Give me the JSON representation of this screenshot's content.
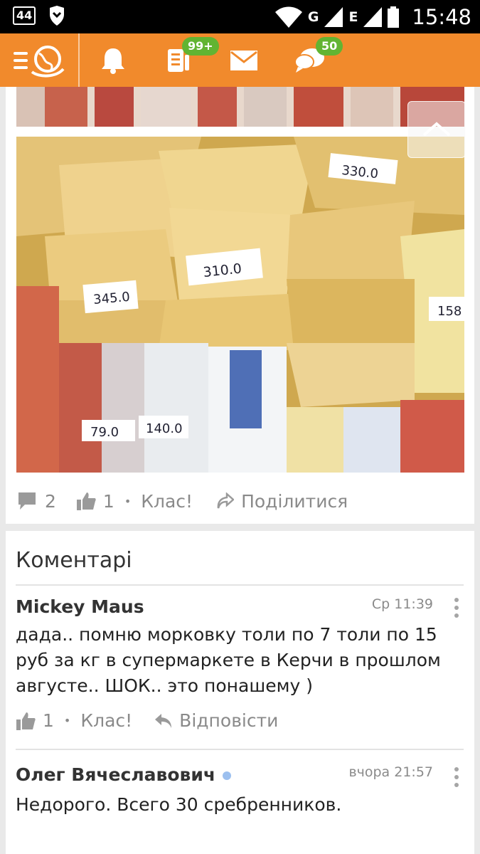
{
  "status_bar": {
    "notification_count": "44",
    "network_1": "G",
    "network_2": "E",
    "time": "15:48"
  },
  "app_bar": {
    "menu_icon": "menu-globe-icon",
    "notifications_icon": "bell-icon",
    "feed_icon": "feed-icon",
    "feed_badge": "99+",
    "messages_icon": "envelope-icon",
    "discussions_icon": "chat-bubbles-icon",
    "discussions_badge": "50",
    "accent": "#f18a2c",
    "badge_color": "#62b432"
  },
  "post": {
    "photo_1": "photo-sausages",
    "photo_2": "photo-cheese-and-butter",
    "price_tags": [
      "330.0",
      "310.0",
      "345.0",
      "158",
      "79.0",
      "140.0"
    ],
    "comments_count": "2",
    "likes_count": "1",
    "like_label": "Клас!",
    "share_label": "Поділитися"
  },
  "comments": {
    "title": "Коментарі",
    "items": [
      {
        "author": "Mickey Maus",
        "time": "Ср 11:39",
        "text": "дада.. помню морковку толи по 7 толи по 15 руб за кг в супермаркете в Керчи в прошлом августе.. ШОК.. это понашему )",
        "likes": "1",
        "like_label": "Клас!",
        "reply_label": "Відповісти"
      },
      {
        "author": "Олег Вячеславович",
        "time": "вчора 21:57",
        "text": "Недорого. Всего 30 сребренников."
      }
    ]
  }
}
